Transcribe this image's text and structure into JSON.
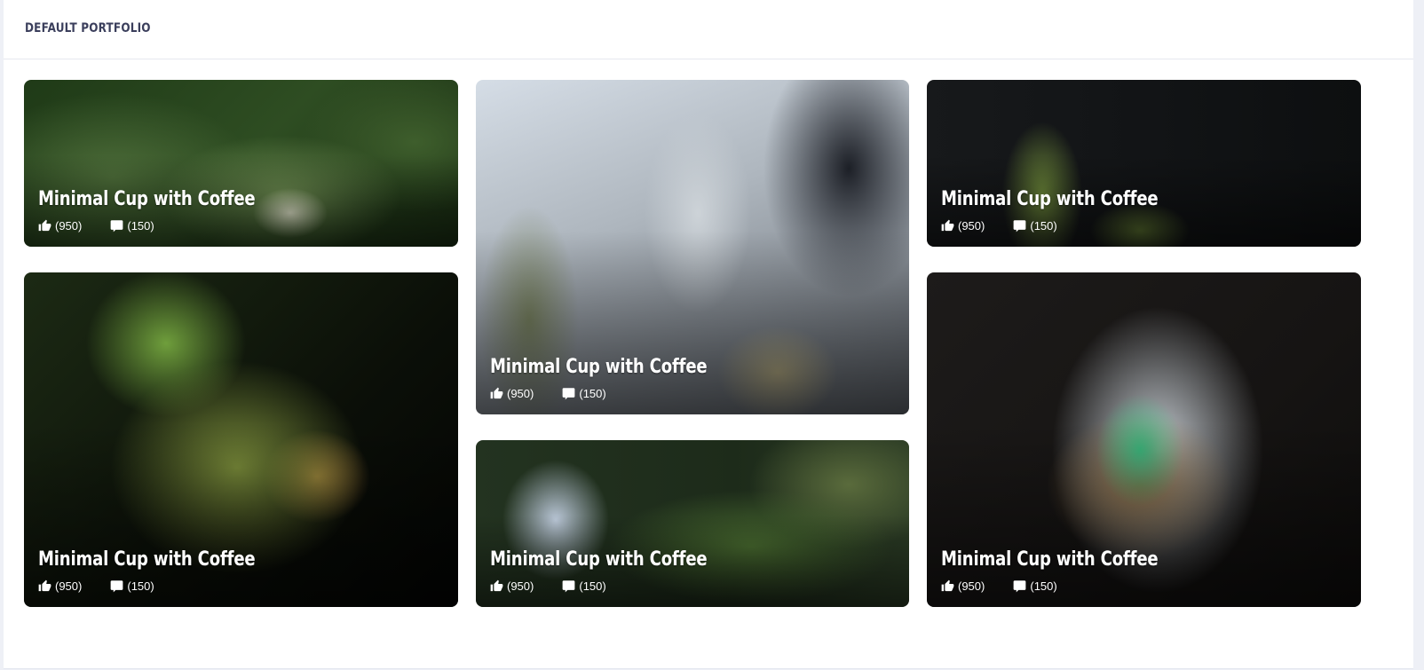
{
  "header": {
    "title": "DEFAULT PORTFOLIO"
  },
  "cards": [
    {
      "image": "cannabis-leaf-closeup",
      "title": "Minimal Cup with Coffee",
      "likes": "(950)",
      "comments": "(150)"
    },
    {
      "image": "tongs-weighing-buds",
      "title": "Minimal Cup with Coffee",
      "likes": "(950)",
      "comments": "(150)"
    },
    {
      "image": "cannabis-plant-dark",
      "title": "Minimal Cup with Coffee",
      "likes": "(950)",
      "comments": "(150)"
    },
    {
      "image": "cannabis-bud-macro",
      "title": "Minimal Cup with Coffee",
      "likes": "(950)",
      "comments": "(150)"
    },
    {
      "image": "gloved-hand-leaf",
      "title": "Minimal Cup with Coffee",
      "likes": "(950)",
      "comments": "(150)"
    },
    {
      "image": "cannabis-in-ziplock-bag",
      "title": "Minimal Cup with Coffee",
      "likes": "(950)",
      "comments": "(150)"
    }
  ],
  "icons": {
    "like": "thumbs-up-icon",
    "comment": "comment-icon"
  },
  "colors": {
    "background": "#eef0f6",
    "panel": "#ffffff",
    "title": "#3b3f5c",
    "caption": "#ffffff"
  }
}
